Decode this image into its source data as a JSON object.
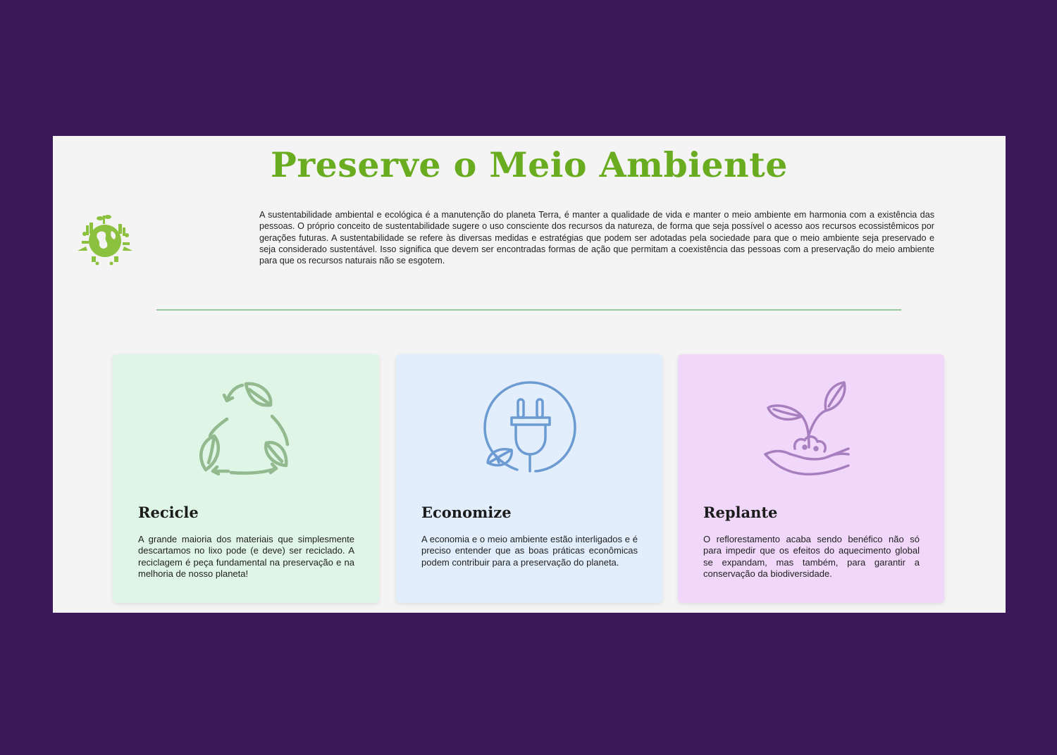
{
  "header": {
    "title": "Preserve o Meio Ambiente"
  },
  "intro": {
    "text": "A sustentabilidade ambiental e ecológica é a manutenção do planeta Terra, é manter a qualidade de vida e manter o meio ambiente em harmonia com a existência das pessoas. O próprio conceito de sustentabilidade sugere o uso consciente dos recursos da natureza, de forma que seja possível o acesso aos recursos ecossistêmicos por gerações futuras. A sustentabilidade se refere às diversas medidas e estratégias que podem ser adotadas pela sociedade para que o meio ambiente seja preservado e seja considerado sustentável. Isso significa que devem ser encontradas formas de ação que permitam a coexistência das pessoas com a preservação do meio ambiente para que os recursos naturais não se esgotem."
  },
  "logo": {
    "icon": "eco-globe-icon",
    "color": "#8cc13f"
  },
  "cards": [
    {
      "icon": "recycle-leaves-icon",
      "title": "Recicle",
      "text": "A grande maioria dos materiais que simplesmente descartamos no lixo pode (e deve) ser reciclado. A reciclagem é peça fundamental na preservação e na melhoria de nosso planeta!",
      "background": "#dff5e6",
      "icon_color": "#93b98f"
    },
    {
      "icon": "eco-plug-icon",
      "title": "Economize",
      "text": "A economia e o meio ambiente estão interligados e é preciso entender que as boas práticas econômicas podem contribuir para a preservação do planeta.",
      "background": "#e2eefc",
      "icon_color": "#6b9bd1"
    },
    {
      "icon": "hand-plant-icon",
      "title": "Replante",
      "text": "O reflorestamento acaba sendo benéfico não só para impedir que os efeitos do aquecimento global se expandam, mas também, para garantir a conservação da biodiversidade.",
      "background": "#f1d8fa",
      "icon_color": "#a77fbf"
    }
  ],
  "colors": {
    "outer_background": "#3a185a",
    "page_background": "#f4f4f4",
    "title": "#6aac1f",
    "divider": "#98c9a3"
  }
}
